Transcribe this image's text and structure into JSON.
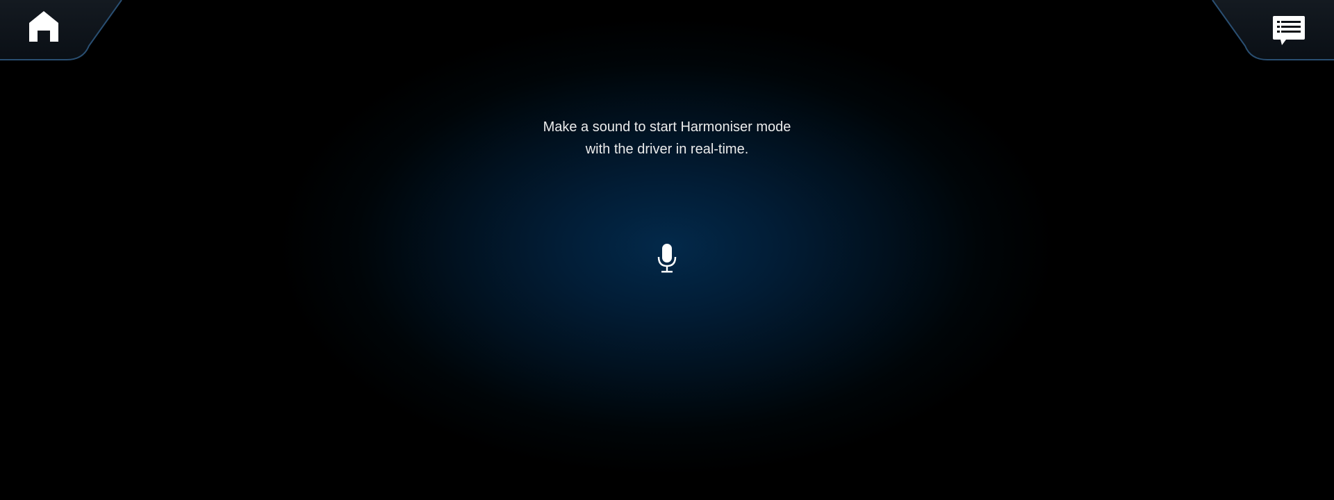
{
  "screen": {
    "background_center_color": "#03294a",
    "background_edge_color": "#000000"
  },
  "top_left": {
    "icon": "home-icon"
  },
  "top_right": {
    "icon": "messages-icon"
  },
  "prompt": {
    "line1": "Make a sound to start Harmoniser mode",
    "line2": "with the driver in real-time."
  },
  "mic": {
    "icon": "microphone-icon"
  }
}
